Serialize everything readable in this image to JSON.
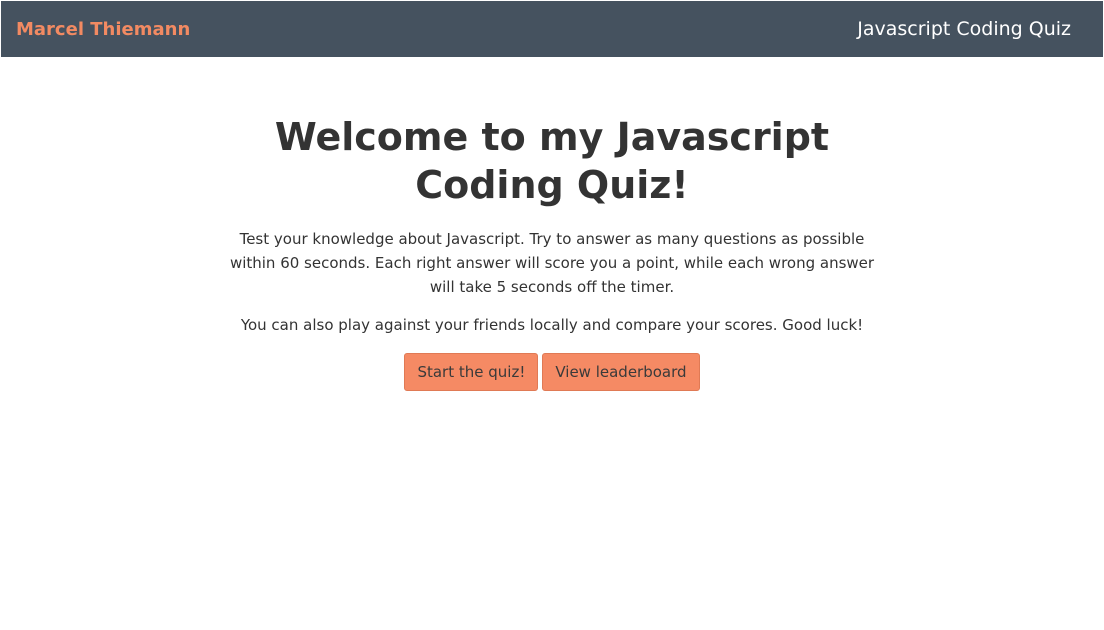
{
  "navbar": {
    "brand": "Marcel Thiemann",
    "title": "Javascript Coding Quiz"
  },
  "main": {
    "heading": "Welcome to my Javascript Coding Quiz!",
    "intro": "Test your knowledge about Javascript. Try to answer as many questions as possible within 60 seconds. Each right answer will score you a point, while each wrong answer will take 5 seconds off the timer.",
    "note": "You can also play against your friends locally and compare your scores. Good luck!",
    "buttons": {
      "start": "Start the quiz!",
      "leaderboard": "View leaderboard"
    }
  },
  "colors": {
    "navbar_bg": "#45525f",
    "brand": "#f28a62",
    "button_bg": "#f58a64"
  }
}
